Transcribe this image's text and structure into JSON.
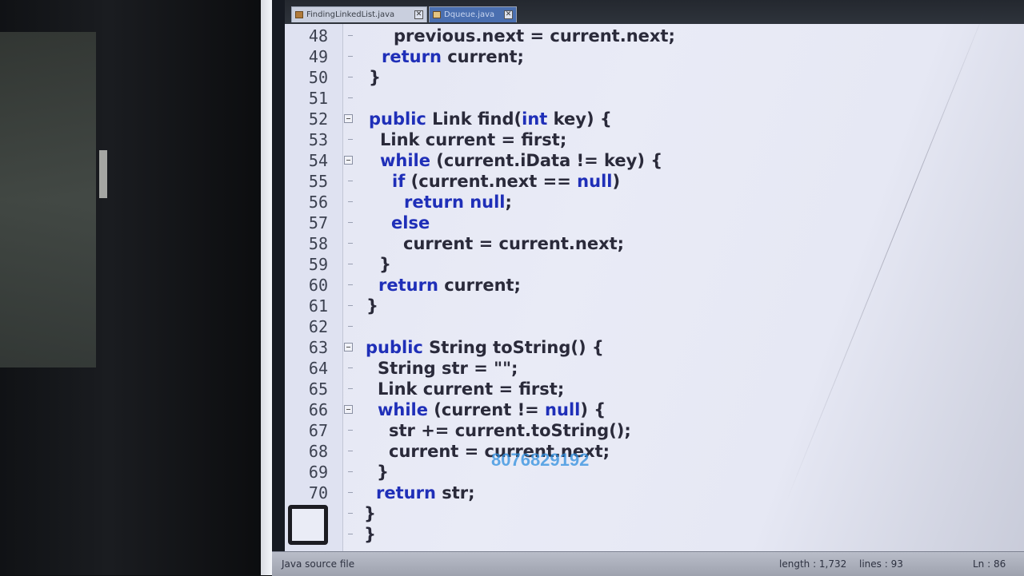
{
  "tabs": [
    {
      "label": "FindingLinkedList.java",
      "active": true
    },
    {
      "label": "Dqueue.java",
      "active": false
    }
  ],
  "tab_close_glyph": "✕",
  "code_lines": [
    {
      "num": "48",
      "indent": 2,
      "segments": [
        {
          "t": "previous.next = current.next;",
          "kw": false
        }
      ],
      "fold": false
    },
    {
      "num": "49",
      "indent": 1,
      "segments": [
        {
          "t": "return",
          "kw": true
        },
        {
          "t": " current;",
          "kw": false
        }
      ],
      "fold": false
    },
    {
      "num": "50",
      "indent": 0,
      "segments": [
        {
          "t": "}",
          "kw": false
        }
      ],
      "fold": false
    },
    {
      "num": "51",
      "indent": 0,
      "segments": [],
      "fold": false
    },
    {
      "num": "52",
      "indent": 0,
      "segments": [
        {
          "t": "public",
          "kw": true
        },
        {
          "t": " Link find(",
          "kw": false
        },
        {
          "t": "int",
          "kw": true
        },
        {
          "t": " key) {",
          "kw": false
        }
      ],
      "fold": true
    },
    {
      "num": "53",
      "indent": 1,
      "segments": [
        {
          "t": "Link current = first;",
          "kw": false
        }
      ],
      "fold": false
    },
    {
      "num": "54",
      "indent": 1,
      "segments": [
        {
          "t": "while",
          "kw": true
        },
        {
          "t": " (current.iData != key) {",
          "kw": false
        }
      ],
      "fold": true
    },
    {
      "num": "55",
      "indent": 2,
      "segments": [
        {
          "t": "if",
          "kw": true
        },
        {
          "t": " (current.next == ",
          "kw": false
        },
        {
          "t": "null",
          "kw": true
        },
        {
          "t": ")",
          "kw": false
        }
      ],
      "fold": false
    },
    {
      "num": "56",
      "indent": 3,
      "segments": [
        {
          "t": "return null",
          "kw": true
        },
        {
          "t": ";",
          "kw": false
        }
      ],
      "fold": false
    },
    {
      "num": "57",
      "indent": 2,
      "segments": [
        {
          "t": "else",
          "kw": true
        }
      ],
      "fold": false
    },
    {
      "num": "58",
      "indent": 3,
      "segments": [
        {
          "t": "current = current.next;",
          "kw": false
        }
      ],
      "fold": false
    },
    {
      "num": "59",
      "indent": 1,
      "segments": [
        {
          "t": "}",
          "kw": false
        }
      ],
      "fold": false
    },
    {
      "num": "60",
      "indent": 1,
      "segments": [
        {
          "t": "return",
          "kw": true
        },
        {
          "t": " current;",
          "kw": false
        }
      ],
      "fold": false
    },
    {
      "num": "61",
      "indent": 0,
      "segments": [
        {
          "t": "}",
          "kw": false
        }
      ],
      "fold": false
    },
    {
      "num": "62",
      "indent": 0,
      "segments": [],
      "fold": false
    },
    {
      "num": "63",
      "indent": 0,
      "segments": [
        {
          "t": "public",
          "kw": true
        },
        {
          "t": " String toString() {",
          "kw": false
        }
      ],
      "fold": true
    },
    {
      "num": "64",
      "indent": 1,
      "segments": [
        {
          "t": "String str = \"\";",
          "kw": false
        }
      ],
      "fold": false
    },
    {
      "num": "65",
      "indent": 1,
      "segments": [
        {
          "t": "Link current = first;",
          "kw": false
        }
      ],
      "fold": false
    },
    {
      "num": "66",
      "indent": 1,
      "segments": [
        {
          "t": "while",
          "kw": true
        },
        {
          "t": " (current != ",
          "kw": false
        },
        {
          "t": "null",
          "kw": true
        },
        {
          "t": ") {",
          "kw": false
        }
      ],
      "fold": true
    },
    {
      "num": "67",
      "indent": 2,
      "segments": [
        {
          "t": "str += current.toString();",
          "kw": false
        }
      ],
      "fold": false
    },
    {
      "num": "68",
      "indent": 2,
      "segments": [
        {
          "t": "current = current.next;",
          "kw": false
        }
      ],
      "fold": false
    },
    {
      "num": "69",
      "indent": 1,
      "segments": [
        {
          "t": "}",
          "kw": false
        }
      ],
      "fold": false
    },
    {
      "num": "70",
      "indent": 1,
      "segments": [
        {
          "t": "return",
          "kw": true
        },
        {
          "t": " str;",
          "kw": false
        }
      ],
      "fold": false
    },
    {
      "num": "",
      "indent": 0,
      "segments": [
        {
          "t": "}",
          "kw": false
        }
      ],
      "fold": false
    },
    {
      "num": "",
      "indent": 0,
      "segments": [
        {
          "t": "}",
          "kw": false
        }
      ],
      "fold": false
    }
  ],
  "watermark": "8076829192",
  "status": {
    "file_type": "Java source file",
    "length": "length : 1,732",
    "lines": "lines : 93",
    "position": "Ln : 86"
  },
  "colors": {
    "keyword": "#1f2fb8",
    "text": "#2a2a3a",
    "background": "#e6e8f4"
  }
}
